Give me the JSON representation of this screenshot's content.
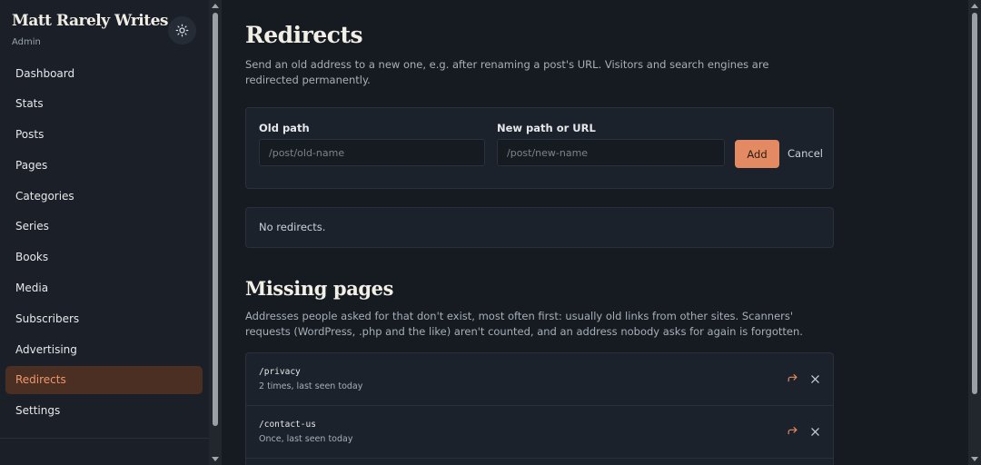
{
  "sidebar": {
    "brand": "Matt Rarely Writes",
    "subtitle": "Admin",
    "theme_icon": "sun-icon",
    "items": [
      {
        "label": "Dashboard",
        "active": false
      },
      {
        "label": "Stats",
        "active": false
      },
      {
        "label": "Posts",
        "active": false
      },
      {
        "label": "Pages",
        "active": false
      },
      {
        "label": "Categories",
        "active": false
      },
      {
        "label": "Series",
        "active": false
      },
      {
        "label": "Books",
        "active": false
      },
      {
        "label": "Media",
        "active": false
      },
      {
        "label": "Subscribers",
        "active": false
      },
      {
        "label": "Advertising",
        "active": false
      },
      {
        "label": "Redirects",
        "active": true
      },
      {
        "label": "Settings",
        "active": false
      }
    ]
  },
  "redirects": {
    "title": "Redirects",
    "description": "Send an old address to a new one, e.g. after renaming a post's URL. Visitors and search engines are redirected permanently.",
    "old_path_label": "Old path",
    "old_path_placeholder": "/post/old-name",
    "old_path_value": "",
    "new_path_label": "New path or URL",
    "new_path_placeholder": "/post/new-name",
    "new_path_value": "",
    "add_label": "Add",
    "cancel_label": "Cancel",
    "empty_text": "No redirects."
  },
  "missing": {
    "title": "Missing pages",
    "description": "Addresses people asked for that don't exist, most often first: usually old links from other sites. Scanners' requests (WordPress, .php and the like) aren't counted, and an address nobody asks for again is forgotten.",
    "rows": [
      {
        "path": "/privacy",
        "meta": "2 times, last seen today"
      },
      {
        "path": "/contact-us",
        "meta": "Once, last seen today"
      }
    ]
  },
  "colors": {
    "accent": "#e38a62",
    "active_bg": "#4a2f22",
    "active_text": "#f0966c"
  }
}
